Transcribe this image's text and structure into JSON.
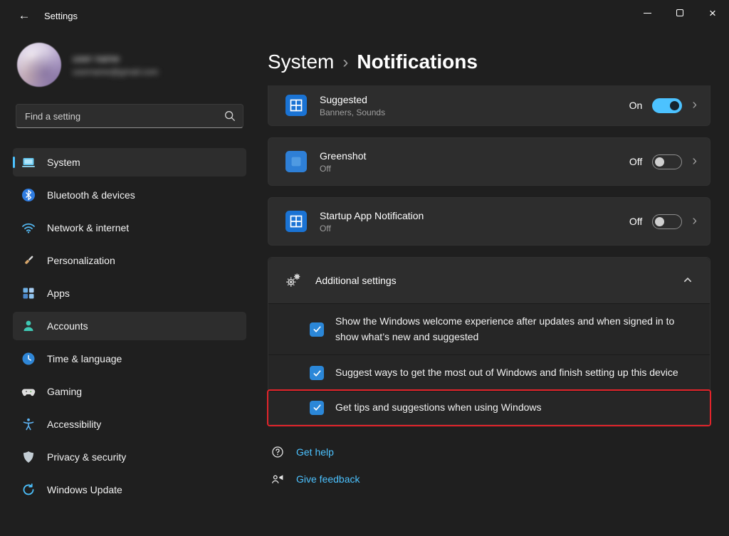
{
  "titlebar": {
    "title": "Settings"
  },
  "icons": {
    "back": "←",
    "close": "×",
    "chevron_right": "›"
  },
  "colors": {
    "accent": "#4cc2ff",
    "checkbox_blue": "#2b87d8",
    "highlight_red": "#e3242b",
    "card_bg": "#2d2d2d",
    "page_bg": "#1f1f1f"
  },
  "sidebar": {
    "user": {
      "name": "user name",
      "email": "username@gmail.com"
    },
    "search": {
      "placeholder": "Find a setting"
    },
    "items": [
      {
        "label": "System",
        "icon": "monitor-icon",
        "selected": true
      },
      {
        "label": "Bluetooth & devices",
        "icon": "bluetooth-icon"
      },
      {
        "label": "Network & internet",
        "icon": "wifi-icon"
      },
      {
        "label": "Personalization",
        "icon": "brush-icon"
      },
      {
        "label": "Apps",
        "icon": "apps-grid-icon"
      },
      {
        "label": "Accounts",
        "icon": "person-icon",
        "highlighted": true
      },
      {
        "label": "Time & language",
        "icon": "clock-icon"
      },
      {
        "label": "Gaming",
        "icon": "controller-icon"
      },
      {
        "label": "Accessibility",
        "icon": "accessibility-icon"
      },
      {
        "label": "Privacy & security",
        "icon": "shield-icon"
      },
      {
        "label": "Windows Update",
        "icon": "update-icon"
      }
    ]
  },
  "main": {
    "breadcrumb": {
      "parent": "System",
      "separator": "›",
      "current": "Notifications"
    },
    "cards": [
      {
        "title": "Suggested",
        "subtitle": "Banners, Sounds",
        "state": "On",
        "toggle": "on",
        "icon": "window-grid-icon"
      },
      {
        "title": "Greenshot",
        "subtitle": "Off",
        "state": "Off",
        "toggle": "off",
        "icon": "greenshot-icon"
      },
      {
        "title": "Startup App Notification",
        "subtitle": "Off",
        "state": "Off",
        "toggle": "off",
        "icon": "window-grid-icon"
      }
    ],
    "additional": {
      "title": "Additional settings",
      "icon": "gears-icon",
      "expanded": true
    },
    "checkboxes": [
      {
        "label": "Show the Windows welcome experience after updates and when signed in to show what’s new and suggested",
        "checked": true
      },
      {
        "label": "Suggest ways to get the most out of Windows and finish setting up this device",
        "checked": true
      },
      {
        "label": "Get tips and suggestions when using Windows",
        "checked": true,
        "highlighted": true
      }
    ],
    "footer": {
      "help": "Get help",
      "feedback": "Give feedback"
    }
  }
}
